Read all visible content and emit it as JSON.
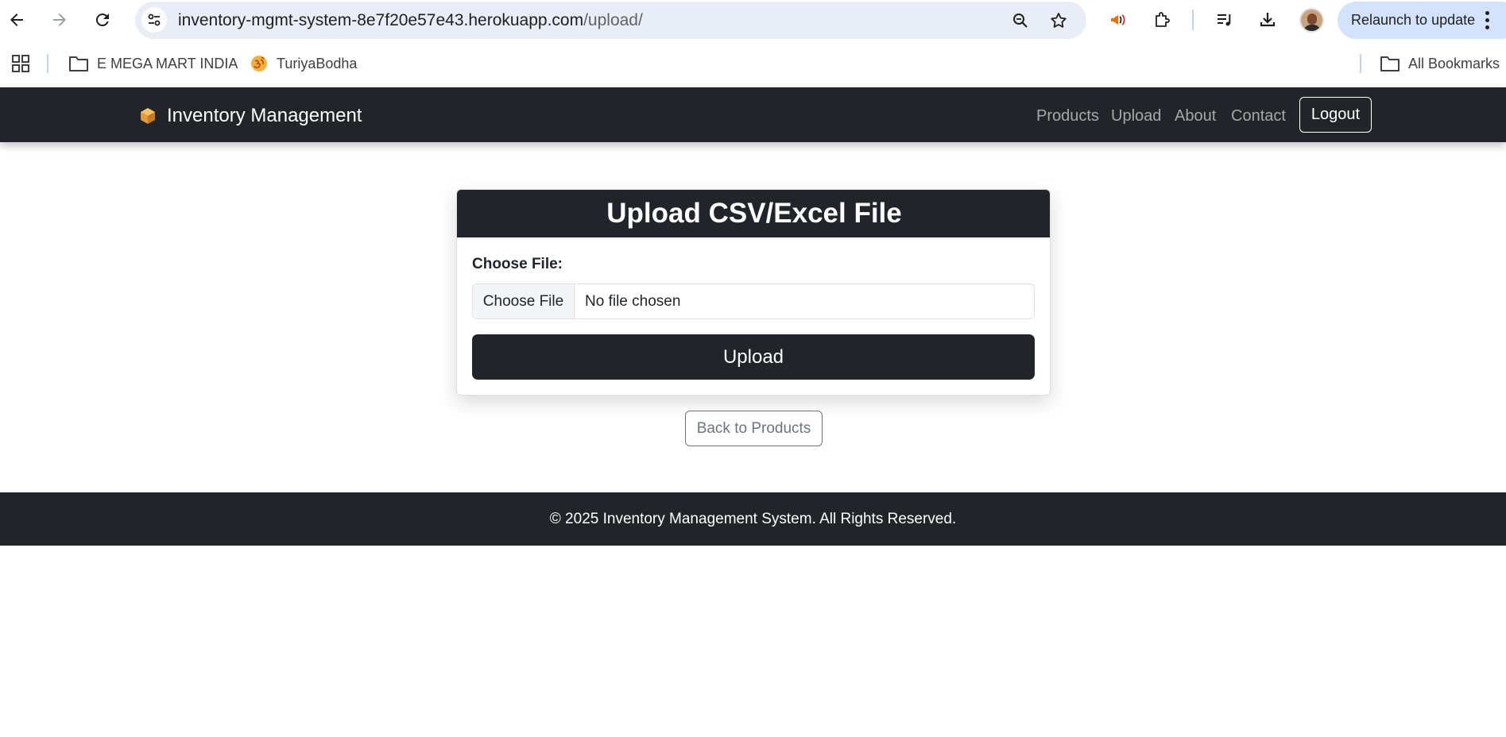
{
  "browser": {
    "url_host": "inventory-mgmt-system-8e7f20e57e43.herokuapp.com",
    "url_path": "/upload/",
    "relaunch_label": "Relaunch to update",
    "bookmarks": [
      {
        "label": "E MEGA MART INDIA",
        "icon": "folder-icon"
      },
      {
        "label": "TuriyaBodha",
        "icon": "om-icon"
      }
    ],
    "all_bookmarks_label": "All Bookmarks"
  },
  "navbar": {
    "brand_icon": "package-icon",
    "brand": "Inventory Management",
    "links": [
      "Products",
      "Upload",
      "About",
      "Contact"
    ],
    "logout_label": "Logout"
  },
  "upload_card": {
    "title": "Upload CSV/Excel File",
    "field_label": "Choose File:",
    "file_button_label": "Choose File",
    "file_status": "No file chosen",
    "submit_label": "Upload"
  },
  "back_label": "Back to Products",
  "footer": {
    "text": "© 2025 Inventory Management System. All Rights Reserved."
  },
  "colors": {
    "dark": "#212529",
    "nav_link": "#a6a8ab",
    "omnibox": "#e9eef6",
    "relaunch": "#d3e3fd"
  }
}
